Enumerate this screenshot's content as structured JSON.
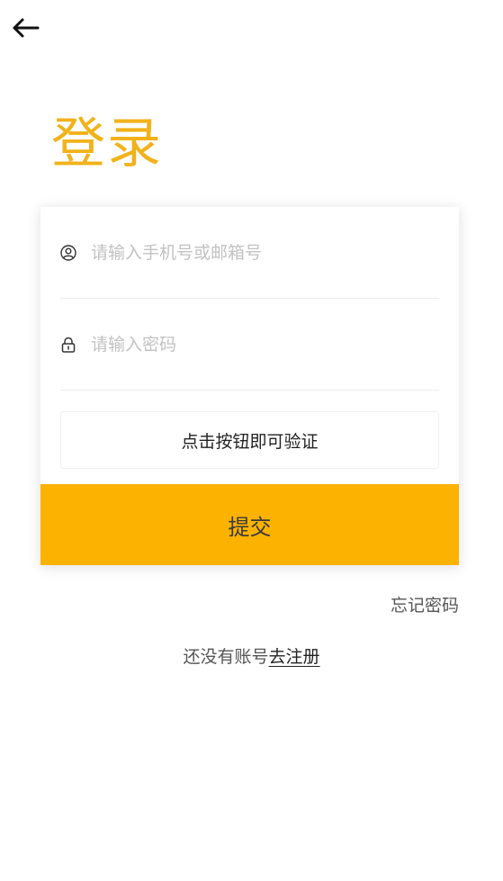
{
  "header": {
    "back_icon": "arrow-left-icon"
  },
  "title": "登录",
  "form": {
    "account": {
      "icon": "user-circle-icon",
      "placeholder": "请输入手机号或邮箱号",
      "value": ""
    },
    "password": {
      "icon": "lock-icon",
      "placeholder": "请输入密码",
      "value": ""
    },
    "verify_label": "点击按钮即可验证",
    "submit_label": "提交"
  },
  "links": {
    "forgot_password": "忘记密码",
    "no_account_text": "还没有账号",
    "register_label": "去注册"
  },
  "colors": {
    "accent": "#fcb201",
    "title": "#f1b21a"
  }
}
